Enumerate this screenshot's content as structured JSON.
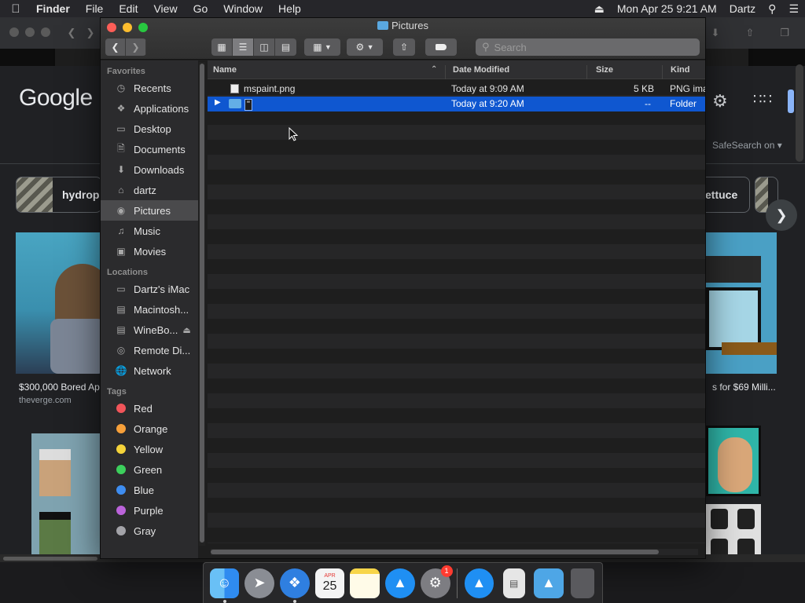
{
  "menubar": {
    "apple_icon": "apple-icon",
    "app_name": "Finder",
    "menus": [
      "File",
      "Edit",
      "View",
      "Go",
      "Window",
      "Help"
    ],
    "clock": "Mon Apr 25  9:21 AM",
    "user": "Dartz"
  },
  "browser": {
    "logo": "Google",
    "safesearch": "SafeSearch on",
    "chips": [
      "hydrop",
      "ettuce"
    ],
    "caption_left": "$300,000 Bored Ap",
    "source_left": "theverge.com",
    "caption_right": "s for $69 Milli..."
  },
  "finder": {
    "title": "Pictures",
    "search_placeholder": "Search",
    "sidebar": {
      "favorites_header": "Favorites",
      "favorites": [
        {
          "label": "Recents",
          "icon": "clock-icon"
        },
        {
          "label": "Applications",
          "icon": "applications-icon"
        },
        {
          "label": "Desktop",
          "icon": "desktop-icon"
        },
        {
          "label": "Documents",
          "icon": "documents-icon"
        },
        {
          "label": "Downloads",
          "icon": "downloads-icon"
        },
        {
          "label": "dartz",
          "icon": "home-icon"
        },
        {
          "label": "Pictures",
          "icon": "camera-icon",
          "selected": true
        },
        {
          "label": "Music",
          "icon": "music-icon"
        },
        {
          "label": "Movies",
          "icon": "movies-icon"
        }
      ],
      "locations_header": "Locations",
      "locations": [
        {
          "label": "Dartz's iMac",
          "icon": "imac-icon"
        },
        {
          "label": "Macintosh...",
          "icon": "disk-icon"
        },
        {
          "label": "WineBo...",
          "icon": "disk-icon",
          "eject": true
        },
        {
          "label": "Remote Di...",
          "icon": "remote-disc-icon"
        },
        {
          "label": "Network",
          "icon": "network-icon"
        }
      ],
      "tags_header": "Tags",
      "tags": [
        {
          "label": "Red",
          "color": "#f2555a"
        },
        {
          "label": "Orange",
          "color": "#f7a03a"
        },
        {
          "label": "Yellow",
          "color": "#f5d33a"
        },
        {
          "label": "Green",
          "color": "#3ccf5c"
        },
        {
          "label": "Blue",
          "color": "#3e8df0"
        },
        {
          "label": "Purple",
          "color": "#bb63da"
        },
        {
          "label": "Gray",
          "color": "#a3a3a8"
        }
      ]
    },
    "columns": {
      "name": "Name",
      "date": "Date Modified",
      "size": "Size",
      "kind": "Kind"
    },
    "files": [
      {
        "name": "mspaint.png",
        "date": "Today at 9:09 AM",
        "size": "5 KB",
        "kind": "PNG ima",
        "type": "file"
      },
      {
        "name": "\"",
        "date": "Today at 9:20 AM",
        "size": "--",
        "kind": "Folder",
        "type": "folder",
        "selected": true,
        "renaming": true
      }
    ]
  },
  "dock": {
    "items": [
      "finder-icon",
      "launchpad-icon",
      "safari-icon",
      "calendar-icon",
      "notes-icon",
      "app-store-icon",
      "system-preferences-icon",
      "applications-folder-icon",
      "document-icon",
      "downloads-folder-icon",
      "trash-icon"
    ],
    "calendar_month": "APR",
    "calendar_day": "25",
    "prefs_badge": "1"
  }
}
